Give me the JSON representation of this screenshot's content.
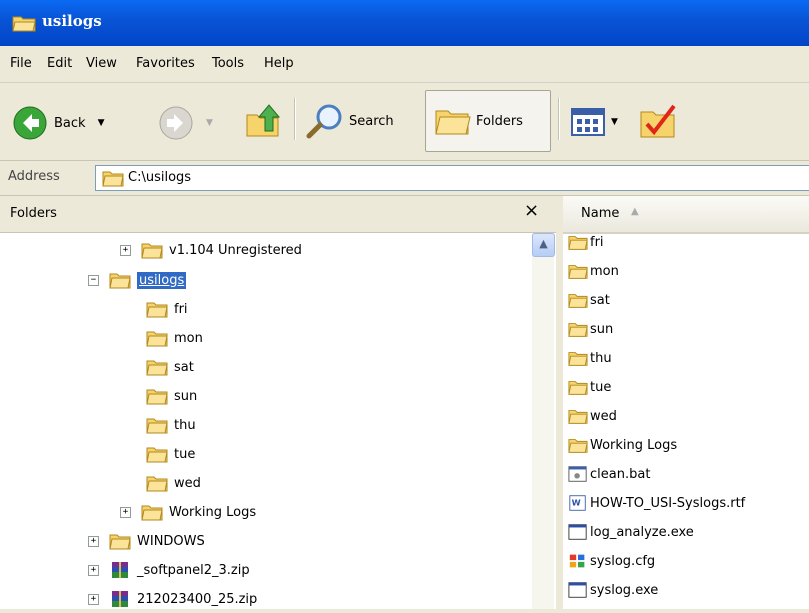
{
  "window": {
    "title": "usilogs"
  },
  "menu": [
    "File",
    "Edit",
    "View",
    "Favorites",
    "Tools",
    "Help"
  ],
  "toolbar": {
    "back_label": "Back",
    "search_label": "Search",
    "folders_label": "Folders"
  },
  "address": {
    "label": "Address",
    "value": "C:\\usilogs"
  },
  "folders_pane": {
    "title": "Folders",
    "close": "×",
    "tree": [
      {
        "label": "v1.104 Unregistered",
        "expander": "+"
      },
      {
        "label": "usilogs",
        "expander": "−",
        "selected": true
      },
      {
        "label": "fri"
      },
      {
        "label": "mon"
      },
      {
        "label": "sat"
      },
      {
        "label": "sun"
      },
      {
        "label": "thu"
      },
      {
        "label": "tue"
      },
      {
        "label": "wed"
      },
      {
        "label": "Working Logs",
        "expander": "+"
      },
      {
        "label": "WINDOWS",
        "expander": "+"
      },
      {
        "label": "_softpanel2_3.zip",
        "expander": "+"
      },
      {
        "label": "212023400_25.zip",
        "expander": "+"
      }
    ]
  },
  "files_pane": {
    "column_name": "Name",
    "sort_indicator": "▲",
    "items": [
      {
        "name": "fri",
        "icon": "folder-icon"
      },
      {
        "name": "mon",
        "icon": "folder-icon"
      },
      {
        "name": "sat",
        "icon": "folder-icon"
      },
      {
        "name": "sun",
        "icon": "folder-icon"
      },
      {
        "name": "thu",
        "icon": "folder-icon"
      },
      {
        "name": "tue",
        "icon": "folder-icon"
      },
      {
        "name": "wed",
        "icon": "folder-icon"
      },
      {
        "name": "Working Logs",
        "icon": "folder-icon"
      },
      {
        "name": "clean.bat",
        "icon": "batch-file-icon"
      },
      {
        "name": "HOW-TO_USI-Syslogs.rtf",
        "icon": "word-document-icon"
      },
      {
        "name": "log_analyze.exe",
        "icon": "executable-icon"
      },
      {
        "name": "syslog.cfg",
        "icon": "config-file-icon"
      },
      {
        "name": "syslog.exe",
        "icon": "executable-icon"
      }
    ]
  },
  "colors": {
    "titlebar": "#0853d4",
    "selection": "#316ac5",
    "folder": "#f6d36b"
  }
}
